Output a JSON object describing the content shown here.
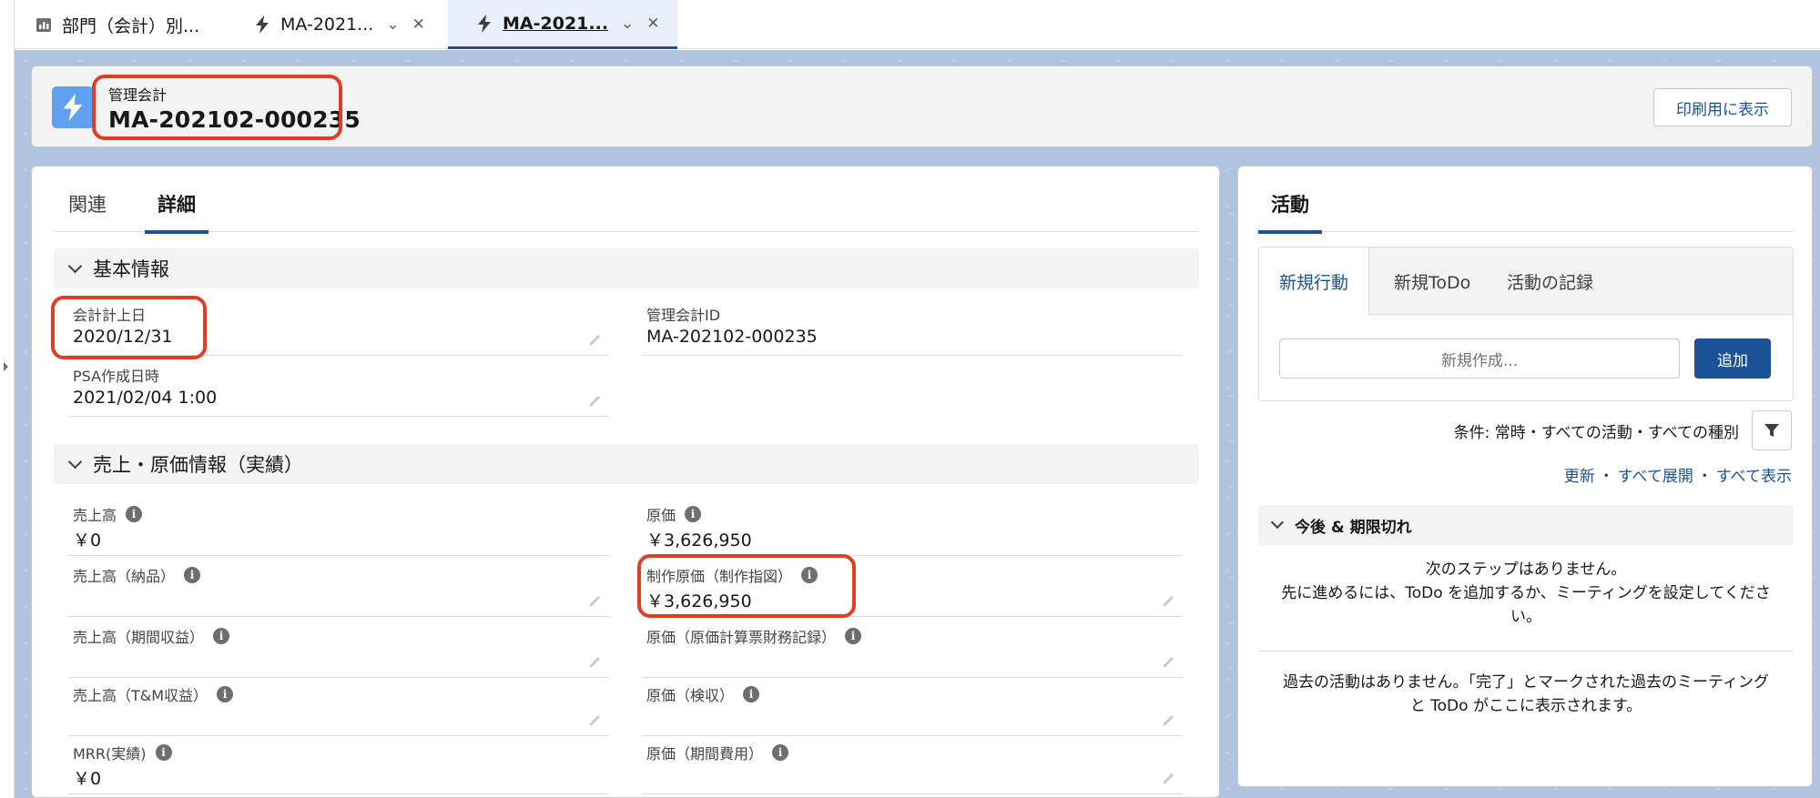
{
  "window_tabs": [
    {
      "label": "部門（会計）別...",
      "icon": "report-icon"
    },
    {
      "label": "MA-2021...",
      "icon": "lightning-icon"
    },
    {
      "label": "MA-2021...",
      "icon": "lightning-icon",
      "active": true
    }
  ],
  "header": {
    "object_label": "管理会計",
    "record_name": "MA-202102-000235",
    "print_button": "印刷用に表示"
  },
  "main": {
    "tabs": [
      "関連",
      "詳細"
    ],
    "active_tab": "詳細",
    "sections": [
      {
        "title": "基本情報",
        "fields": [
          {
            "label": "会計計上日",
            "value": "2020/12/31"
          },
          {
            "label": "管理会計ID",
            "value": "MA-202102-000235"
          },
          {
            "label": "PSA作成日時",
            "value": "2021/02/04 1:00"
          }
        ]
      },
      {
        "title": "売上・原価情報（実績）",
        "fields": [
          {
            "label": "売上高",
            "value": "￥0"
          },
          {
            "label": "原価",
            "value": "￥3,626,950"
          },
          {
            "label": "売上高（納品）",
            "value": ""
          },
          {
            "label": "制作原価（制作指図）",
            "value": "￥3,626,950"
          },
          {
            "label": "売上高（期間収益）",
            "value": ""
          },
          {
            "label": "原価（原価計算票財務記録）",
            "value": ""
          },
          {
            "label": "売上高（T&M収益）",
            "value": ""
          },
          {
            "label": "原価（検収）",
            "value": ""
          },
          {
            "label": "MRR(実績)",
            "value": "￥0"
          },
          {
            "label": "原価（期間費用）",
            "value": ""
          }
        ]
      }
    ]
  },
  "activity": {
    "tab": "活動",
    "publisher_tabs": [
      "新規行動",
      "新規ToDo",
      "活動の記録"
    ],
    "new_placeholder": "新規作成...",
    "add_button": "追加",
    "filter_text": "条件: 常時・すべての活動・すべての種別",
    "links": [
      "更新",
      "すべて展開",
      "すべて表示"
    ],
    "upcoming_title": "今後 & 期限切れ",
    "no_next_steps": "次のステップはありません。",
    "no_next_steps_hint_1": "先に進めるには、ToDo を追加するか、ミーティングを設定してくださ",
    "no_next_steps_hint_2": "い。",
    "no_past_1": "過去の活動はありません。「完了」とマークされた過去のミーティング",
    "no_past_2": "と ToDo がここに表示されます。"
  },
  "colors": {
    "brand": "#1b5297",
    "highlight": "#e03e24",
    "record_icon": "#5fa0f0"
  }
}
